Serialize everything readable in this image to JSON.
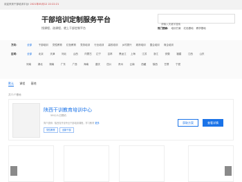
{
  "topbar": {
    "welcome": "欢迎来到干部培训平台!",
    "datetime": "2021年05月12 22:22:21"
  },
  "brand": {
    "title": "干部培训定制服务平台",
    "subtitle": "找课程、选课程、就上干部定制平台"
  },
  "search": {
    "placeholder": "请输入关键字搜索"
  },
  "hot_search": {
    "label": "热门搜索:",
    "items": [
      "培训方案",
      "红色基地",
      "教学基地"
    ]
  },
  "filters": {
    "direction": {
      "label": "方向：",
      "options": [
        "全部",
        "干部培训",
        "党性教育",
        "红色教育",
        "党务培训",
        "行业培训",
        "高校培训",
        "乡村振兴",
        "政府培训",
        "国企培训",
        "商企培训"
      ]
    },
    "region": {
      "label": "区域：",
      "options": [
        "全部",
        "北京",
        "天津",
        "河北",
        "山西",
        "内蒙古",
        "辽宁",
        "吉林",
        "黑龙江",
        "上海",
        "江苏",
        "浙江",
        "安徽",
        "福建",
        "江西",
        "山东"
      ],
      "options_row2": [
        "河南",
        "湖北",
        "湖南",
        "广东",
        "广西",
        "海南",
        "重庆",
        "四川",
        "贵州",
        "云南",
        "西藏",
        "陕西",
        "甘肃",
        "宁夏"
      ]
    }
  },
  "tabs": [
    "默认",
    "课程",
    "基地"
  ],
  "result_count": "共71个基地",
  "card": {
    "name": "陕西干训教育培训中心",
    "meta": "5912人已预约",
    "desc": "简介说明：陕西省开设专业干部培训课程，学习教育",
    "more": "更多",
    "tags": [
      "党性教育",
      "创新干部"
    ],
    "consult_label": "获取方案",
    "detail_label": "查看详情"
  }
}
